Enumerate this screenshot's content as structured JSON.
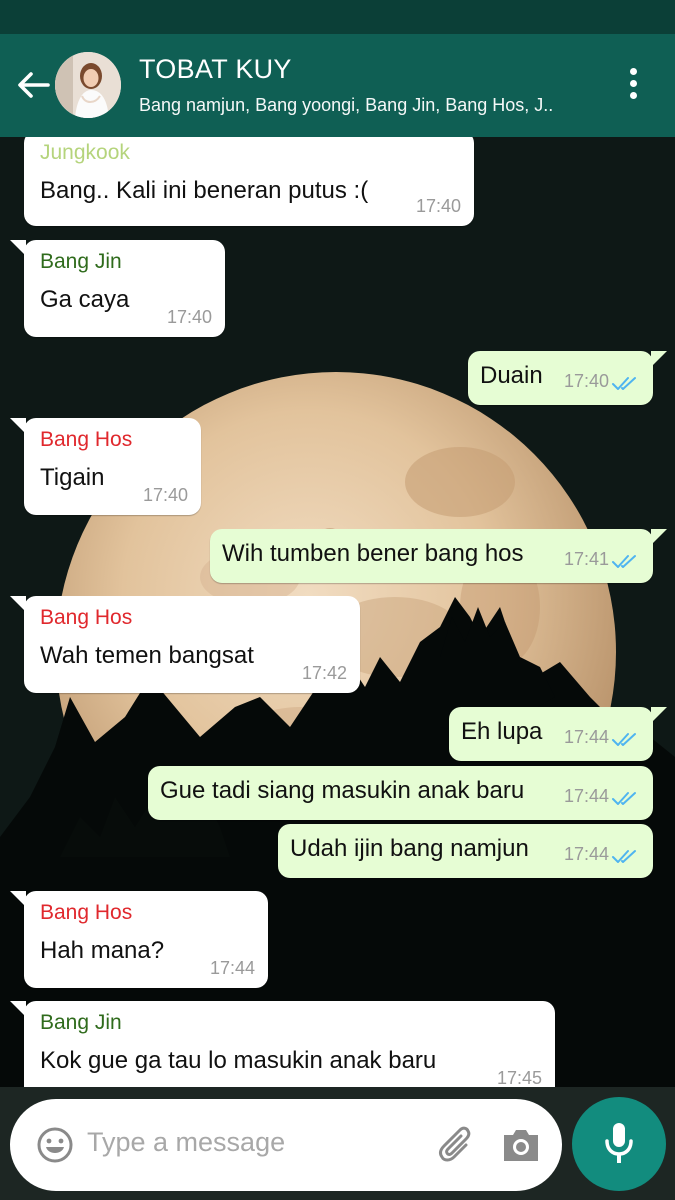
{
  "header": {
    "title": "TOBAT KUY",
    "subtitle": "Bang namjun, Bang yoongi, Bang Jin, Bang Hos, J.."
  },
  "messages": [
    {
      "direction": "in",
      "sender": "Jungkook",
      "sender_color": "#b5d47c",
      "text": "Bang.. Kali ini beneran putus :(",
      "time": "17:40"
    },
    {
      "direction": "in",
      "sender": "Bang Jin",
      "sender_color": "#2f6b1c",
      "text": "Ga caya",
      "time": "17:40"
    },
    {
      "direction": "out",
      "text": "Duain",
      "time": "17:40",
      "read": true
    },
    {
      "direction": "in",
      "sender": "Bang Hos",
      "sender_color": "#e0282d",
      "text": "Tigain",
      "time": "17:40"
    },
    {
      "direction": "out",
      "text": "Wih tumben bener bang hos",
      "time": "17:41",
      "read": true
    },
    {
      "direction": "in",
      "sender": "Bang Hos",
      "sender_color": "#e0282d",
      "text": "Wah temen bangsat",
      "time": "17:42"
    },
    {
      "direction": "out",
      "text": "Eh lupa",
      "time": "17:44",
      "read": true
    },
    {
      "direction": "out",
      "text": "Gue tadi siang masukin anak baru",
      "time": "17:44",
      "read": true
    },
    {
      "direction": "out",
      "text": "Udah ijin bang namjun",
      "time": "17:44",
      "read": true
    },
    {
      "direction": "in",
      "sender": "Bang Hos",
      "sender_color": "#e0282d",
      "text": "Hah mana?",
      "time": "17:44"
    },
    {
      "direction": "in",
      "sender": "Bang Jin",
      "sender_color": "#2f6b1c",
      "text": "Kok gue ga tau lo masukin anak baru",
      "time": "17:45"
    }
  ],
  "input": {
    "placeholder": "Type a message"
  },
  "colors": {
    "header": "#0f5f54",
    "outgoing_bubble": "#e6fdd4",
    "read_ticks": "#4fb4f0",
    "mic_button": "#128c7e"
  },
  "icons": [
    "back-arrow-icon",
    "kebab-menu-icon",
    "emoji-icon",
    "attach-icon",
    "camera-icon",
    "mic-icon",
    "double-check-icon"
  ]
}
